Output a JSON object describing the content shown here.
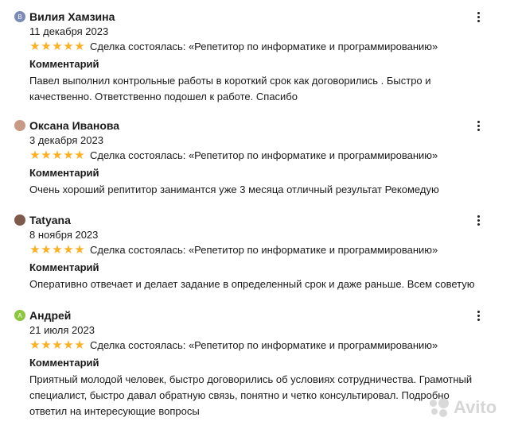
{
  "deal_prefix": "Сделка состоялась:",
  "comment_label": "Комментарий",
  "reviews": [
    {
      "avatar_letter": "В",
      "avatar_color": "#7a8bb5",
      "name": "Вилия Хамзина",
      "date": "11 декабря 2023",
      "rating": 5,
      "deal": "«Репетитор по информатике и программированию»",
      "comment": "Павел выполнил контрольные работы в короткий срок как договорились . Быстро и качественно. Ответственно подошел к работе. Спасибо"
    },
    {
      "avatar_letter": "",
      "avatar_color": "#c89a86",
      "name": "Оксана Иванова",
      "date": "3 декабря 2023",
      "rating": 5,
      "deal": "«Репетитор по информатике и программированию»",
      "comment": "Очень хороший репититор занимантся уже 3 месяца отличный результат Рекомедую"
    },
    {
      "avatar_letter": "",
      "avatar_color": "#7d5b4a",
      "name": "Tatyana",
      "date": "8 ноября 2023",
      "rating": 5,
      "deal": "«Репетитор по информатике и программированию»",
      "comment": "Оперативно отвечает и делает задание в определенный срок и даже раньше. Всем советую"
    },
    {
      "avatar_letter": "А",
      "avatar_color": "#8cc63f",
      "name": "Андрей",
      "date": "21 июля 2023",
      "rating": 5,
      "deal": "«Репетитор по информатике и программированию»",
      "comment": "Приятный молодой человек, быстро договорились об условиях сотрудничества. Грамотный специалист, быстро давал обратную связь, понятно и четко консультировал. Подробно ответил на интересующие вопросы"
    }
  ],
  "watermark": "Avito"
}
